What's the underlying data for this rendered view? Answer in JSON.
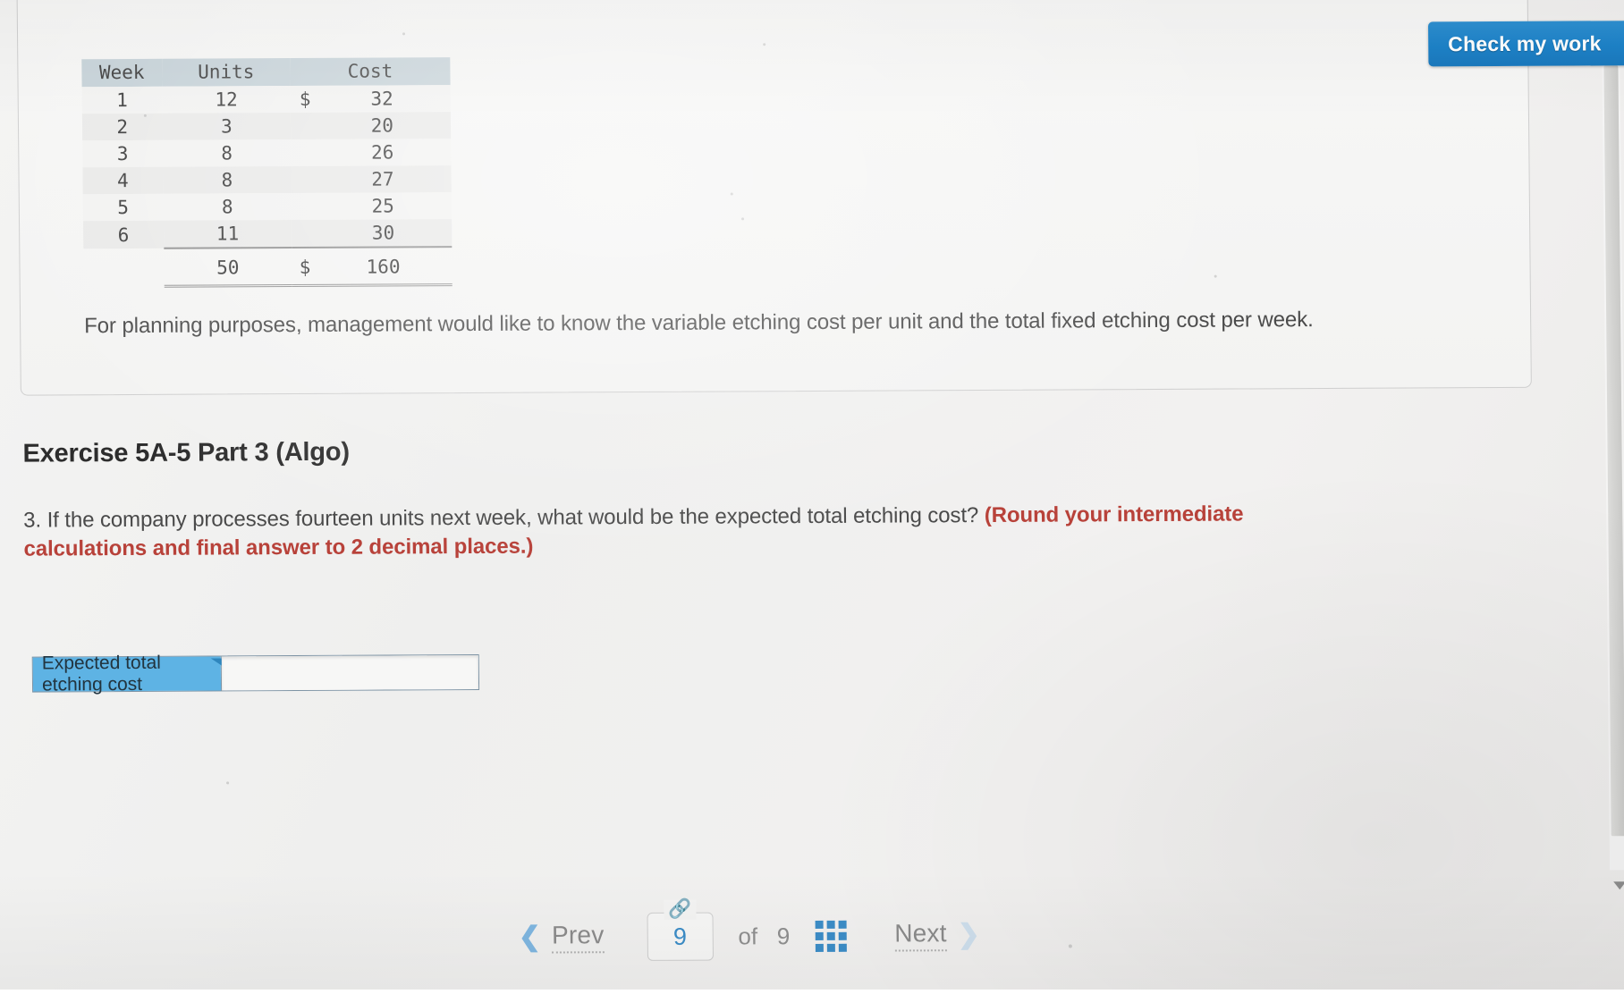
{
  "toolbar": {
    "check_my_work_label": "Check my work"
  },
  "problem": {
    "table": {
      "headers": [
        "Week",
        "Units",
        "Cost"
      ],
      "rows": [
        {
          "week": "1",
          "units": "12",
          "cost_symbol": "$",
          "cost": "32"
        },
        {
          "week": "2",
          "units": "3",
          "cost_symbol": "",
          "cost": "20"
        },
        {
          "week": "3",
          "units": "8",
          "cost_symbol": "",
          "cost": "26"
        },
        {
          "week": "4",
          "units": "8",
          "cost_symbol": "",
          "cost": "27"
        },
        {
          "week": "5",
          "units": "8",
          "cost_symbol": "",
          "cost": "25"
        },
        {
          "week": "6",
          "units": "11",
          "cost_symbol": "",
          "cost": "30"
        }
      ],
      "totals": {
        "units": "50",
        "cost_symbol": "$",
        "cost": "160"
      }
    },
    "paragraph": "For planning purposes, management would like to know the variable etching cost per unit and the total fixed etching cost per week."
  },
  "exercise": {
    "heading": "Exercise 5A-5 Part 3 (Algo)",
    "question_text": "3. If the company processes fourteen units next week, what would be the expected total etching cost? ",
    "question_hint": "(Round your intermediate calculations and final answer to 2 decimal places.)"
  },
  "answer": {
    "label": "Expected total etching cost",
    "value": "",
    "placeholder": ""
  },
  "footer": {
    "prev_label": "Prev",
    "next_label": "Next",
    "current_page": "9",
    "of_label": "of",
    "total_pages": "9",
    "link_icon": "link-icon",
    "grid_icon": "grid-icon"
  },
  "colors": {
    "accent_blue": "#1d82c8",
    "label_blue": "#5eb3e4",
    "hint_red": "#b8423a",
    "table_header": "#c6d2d8"
  }
}
